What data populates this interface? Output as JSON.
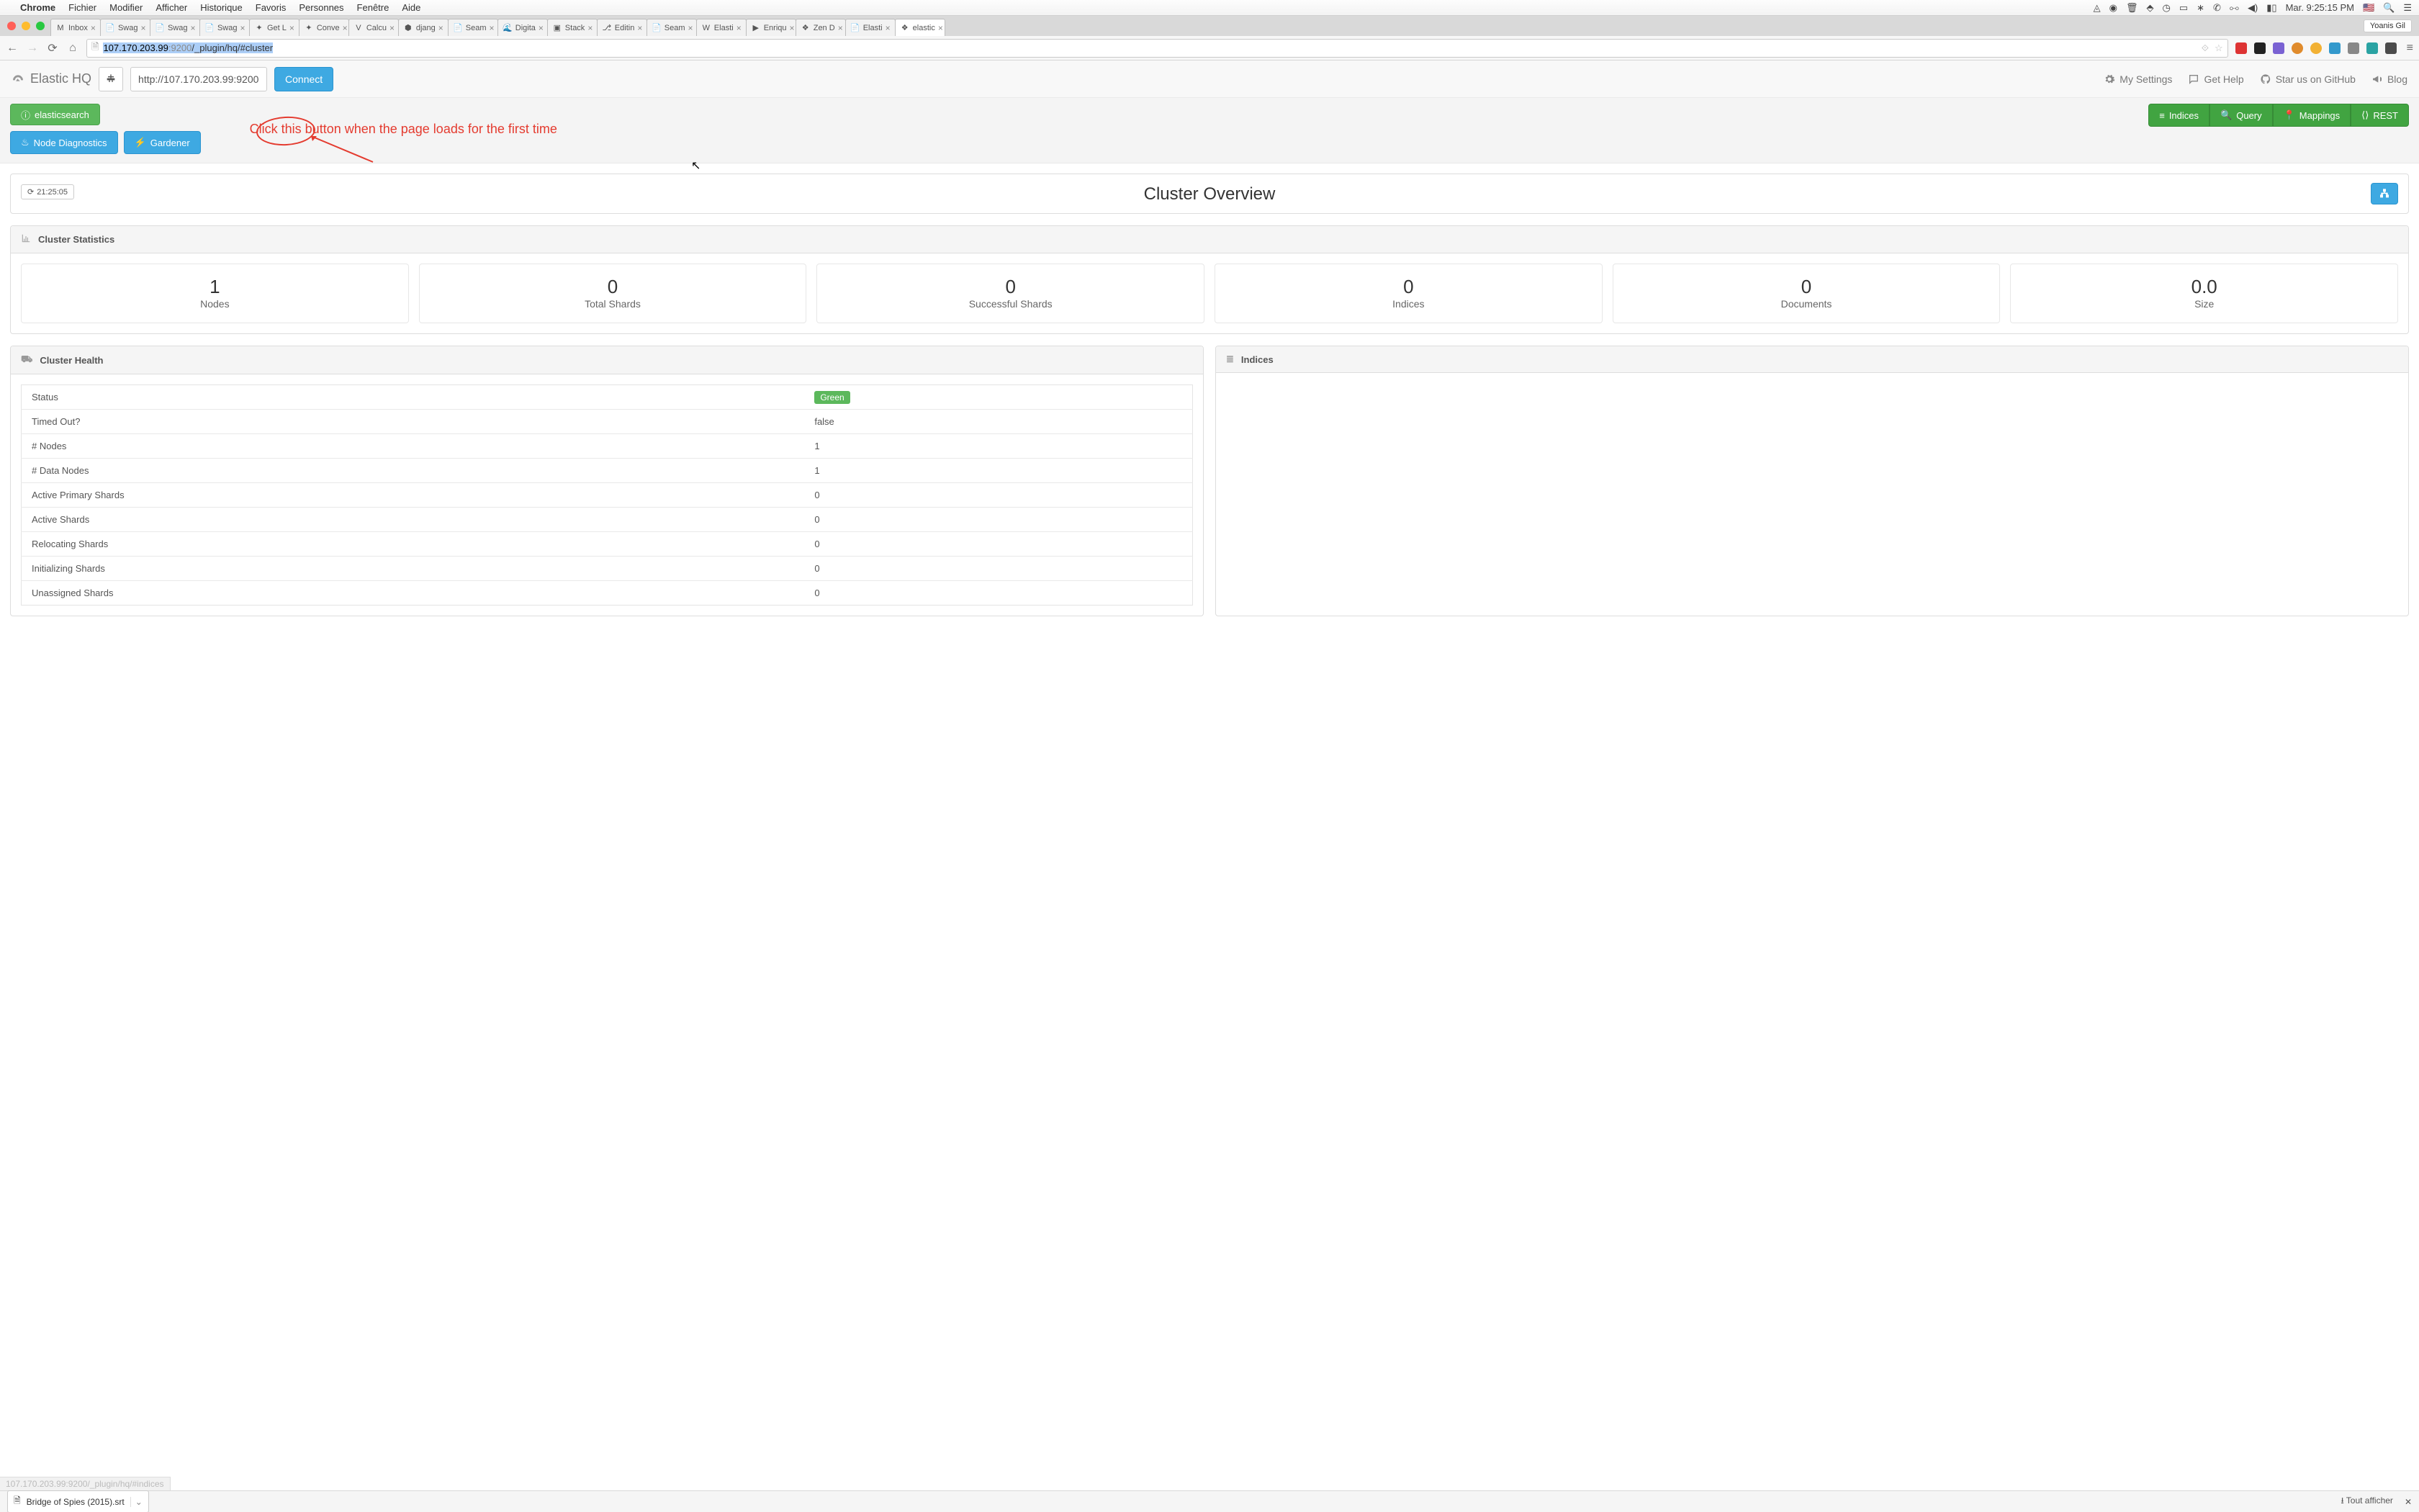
{
  "mac_menu": {
    "app": "Chrome",
    "items": [
      "Fichier",
      "Modifier",
      "Afficher",
      "Historique",
      "Favoris",
      "Personnes",
      "Fenêtre",
      "Aide"
    ],
    "clock": "Mar. 9:25:15 PM"
  },
  "tabs": [
    {
      "label": "Inbox",
      "fav": "M"
    },
    {
      "label": "Swag",
      "fav": "📄"
    },
    {
      "label": "Swag",
      "fav": "📄"
    },
    {
      "label": "Swag",
      "fav": "📄"
    },
    {
      "label": "Get L",
      "fav": "✦"
    },
    {
      "label": "Conve",
      "fav": "✦"
    },
    {
      "label": "Calcu",
      "fav": "V"
    },
    {
      "label": "djang",
      "fav": "⬢"
    },
    {
      "label": "Seam",
      "fav": "📄"
    },
    {
      "label": "Digita",
      "fav": "🌊"
    },
    {
      "label": "Stack",
      "fav": "▣"
    },
    {
      "label": "Editin",
      "fav": "⎇"
    },
    {
      "label": "Seam",
      "fav": "📄"
    },
    {
      "label": "Elasti",
      "fav": "W"
    },
    {
      "label": "Enriqu",
      "fav": "▶"
    },
    {
      "label": "Zen D",
      "fav": "❖"
    },
    {
      "label": "Elasti",
      "fav": "📄"
    },
    {
      "label": "elastic",
      "fav": "❖",
      "active": true
    }
  ],
  "user_badge": "Yoanis Gil",
  "omnibox": {
    "host": "107.170.203.99",
    "port": ":9200",
    "path": "/_plugin/hq/#cluster"
  },
  "app": {
    "brand": "Elastic HQ",
    "connect_url": "http://107.170.203.99:9200",
    "connect_label": "Connect",
    "nav_links": {
      "settings": "My Settings",
      "help": "Get Help",
      "github": "Star us on GitHub",
      "blog": "Blog"
    },
    "cluster_btn": "elasticsearch",
    "diag_btn": "Node Diagnostics",
    "gardener_btn": "Gardener",
    "green_tabs": {
      "indices": "Indices",
      "query": "Query",
      "mappings": "Mappings",
      "rest": "REST"
    }
  },
  "annotation_text": "Click this button when the page loads for the first time",
  "overview": {
    "refresh_time": "21:25:05",
    "title": "Cluster Overview"
  },
  "stats_panel": {
    "heading": "Cluster Statistics",
    "items": [
      {
        "value": "1",
        "label": "Nodes"
      },
      {
        "value": "0",
        "label": "Total Shards"
      },
      {
        "value": "0",
        "label": "Successful Shards"
      },
      {
        "value": "0",
        "label": "Indices"
      },
      {
        "value": "0",
        "label": "Documents"
      },
      {
        "value": "0.0",
        "label": "Size"
      }
    ]
  },
  "health_panel": {
    "heading": "Cluster Health",
    "status_label": "Status",
    "status_value": "Green",
    "rows": [
      {
        "k": "Timed Out?",
        "v": "false"
      },
      {
        "k": "# Nodes",
        "v": "1"
      },
      {
        "k": "# Data Nodes",
        "v": "1"
      },
      {
        "k": "Active Primary Shards",
        "v": "0"
      },
      {
        "k": "Active Shards",
        "v": "0"
      },
      {
        "k": "Relocating Shards",
        "v": "0"
      },
      {
        "k": "Initializing Shards",
        "v": "0"
      },
      {
        "k": "Unassigned Shards",
        "v": "0"
      }
    ]
  },
  "indices_panel": {
    "heading": "Indices"
  },
  "hover_url": "107.170.203.99:9200/_plugin/hq/#indices",
  "downloads": {
    "file": "Bridge of Spies (2015).srt",
    "show_all": "Tout afficher"
  }
}
